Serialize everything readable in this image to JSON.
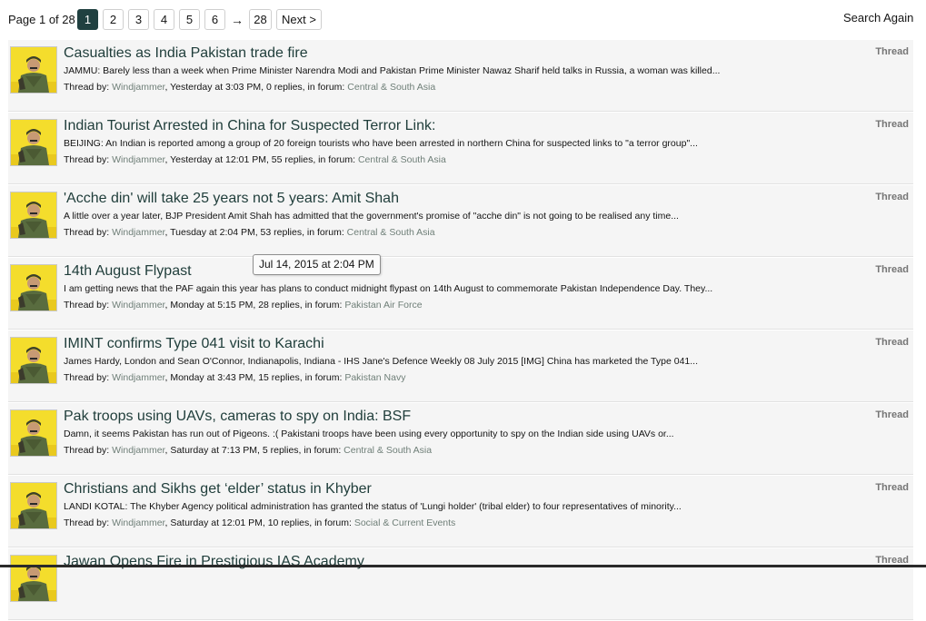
{
  "pagination": {
    "label": "Page 1 of 28",
    "pages": [
      "1",
      "2",
      "3",
      "4",
      "5",
      "6"
    ],
    "current": "1",
    "arrow": "→",
    "last": "28",
    "next": "Next >"
  },
  "search_again": "Search Again",
  "tooltip": "Jul 14, 2015 at 2:04 PM",
  "results": [
    {
      "title": "Casualties as India Pakistan trade fire",
      "snippet": "JAMMU: Barely less than a week when Prime Minister Narendra Modi and Pakistan Prime Minister Nawaz Sharif held talks in Russia, a woman was killed...",
      "meta_prefix": "Thread by: ",
      "author": "Windjammer",
      "meta_middle": ", Yesterday at 3:03 PM, 0 replies, in forum: ",
      "forum": "Central & South Asia",
      "type": "Thread"
    },
    {
      "title": "Indian Tourist Arrested in China for Suspected Terror Link:",
      "snippet": "BEIJING: An Indian is reported among a group of 20 foreign tourists who have been arrested in northern China for suspected links to \"a terror group\"...",
      "meta_prefix": "Thread by: ",
      "author": "Windjammer",
      "meta_middle": ", Yesterday at 12:01 PM, 55 replies, in forum: ",
      "forum": "Central & South Asia",
      "type": "Thread"
    },
    {
      "title": "'Acche din' will take 25 years not 5 years: Amit Shah",
      "snippet": "A little over a year later, BJP President Amit Shah has admitted that the government's promise of \"acche din\" is not going to be realised any time...",
      "meta_prefix": "Thread by: ",
      "author": "Windjammer",
      "meta_middle": ", Tuesday at 2:04 PM, 53 replies, in forum: ",
      "forum": "Central & South Asia",
      "type": "Thread"
    },
    {
      "title": "14th August Flypast",
      "snippet": "I am getting news that the PAF again this year has plans to conduct midnight flypast on 14th August to commemorate Pakistan Independence Day. They...",
      "meta_prefix": "Thread by: ",
      "author": "Windjammer",
      "meta_middle": ", Monday at 5:15 PM, 28 replies, in forum: ",
      "forum": "Pakistan Air Force",
      "type": "Thread"
    },
    {
      "title": "IMINT confirms Type 041 visit to Karachi",
      "snippet": "James Hardy, London and Sean O'Connor, Indianapolis, Indiana - IHS Jane's Defence Weekly 08 July 2015 [IMG] China has marketed the Type 041...",
      "meta_prefix": "Thread by: ",
      "author": "Windjammer",
      "meta_middle": ", Monday at 3:43 PM, 15 replies, in forum: ",
      "forum": "Pakistan Navy",
      "type": "Thread"
    },
    {
      "title": "Pak troops using UAVs, cameras to spy on India: BSF",
      "snippet": "Damn, it seems Pakistan has run out of Pigeons. :( Pakistani troops have been using every opportunity to spy on the Indian side using UAVs or...",
      "meta_prefix": "Thread by: ",
      "author": "Windjammer",
      "meta_middle": ", Saturday at 7:13 PM, 5 replies, in forum: ",
      "forum": "Central & South Asia",
      "type": "Thread"
    },
    {
      "title": "Christians and Sikhs get ‘elder’ status in Khyber",
      "snippet": "LANDI KOTAL: The Khyber Agency political administration has granted the status of 'Lungi holder' (tribal elder) to four representatives of minority...",
      "meta_prefix": "Thread by: ",
      "author": "Windjammer",
      "meta_middle": ", Saturday at 12:01 PM, 10 replies, in forum: ",
      "forum": "Social & Current Events",
      "type": "Thread"
    },
    {
      "title": "Jawan Opens Fire in Prestigious IAS Academy",
      "snippet": "",
      "meta_prefix": "",
      "author": "",
      "meta_middle": "",
      "forum": "",
      "type": "Thread"
    }
  ]
}
